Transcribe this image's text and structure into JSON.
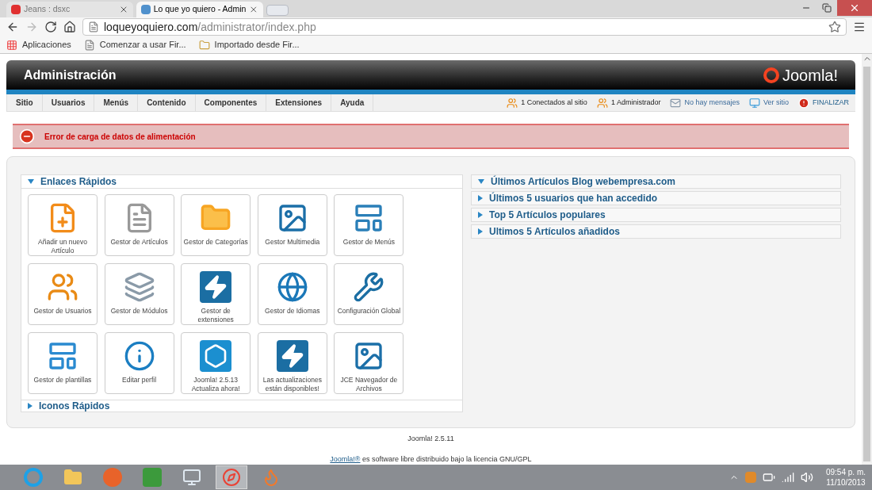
{
  "browser": {
    "tabs": [
      {
        "title": "Jeans : dsxc",
        "selected": false
      },
      {
        "title": "Lo que yo quiero - Admin",
        "selected": true
      }
    ],
    "url": {
      "host": "loqueyoquiero.com",
      "path": "/administrator/index.php"
    },
    "bookmarks": [
      {
        "label": "Aplicaciones",
        "kind": "apps"
      },
      {
        "label": "Comenzar a usar Fir...",
        "kind": "page"
      },
      {
        "label": "Importado desde Fir...",
        "kind": "folder"
      }
    ]
  },
  "header": {
    "title": "Administración",
    "logo": "Joomla!"
  },
  "menu": [
    "Sitio",
    "Usuarios",
    "Menús",
    "Contenido",
    "Componentes",
    "Extensiones",
    "Ayuda"
  ],
  "status": [
    {
      "label": "1 Conectados al sitio",
      "kind": "users"
    },
    {
      "label": "1 Administrador",
      "kind": "users"
    },
    {
      "label": "No hay mensajes",
      "kind": "mail"
    },
    {
      "label": "Ver sitio",
      "kind": "screen"
    },
    {
      "label": "FINALIZAR",
      "kind": "logout"
    }
  ],
  "alert": "Error de carga de datos de alimentación",
  "quick_links": {
    "title": "Enlaces Rápidos",
    "expanded": true,
    "tiles": [
      {
        "label": "Añadir un nuevo Artículo",
        "kind": "add"
      },
      {
        "label": "Gestor de Artículos",
        "kind": "article"
      },
      {
        "label": "Gestor de Categorías",
        "kind": "folder"
      },
      {
        "label": "Gestor Multimedia",
        "kind": "media"
      },
      {
        "label": "Gestor de Menús",
        "kind": "menu"
      },
      {
        "label": "Gestor de Usuarios",
        "kind": "users"
      },
      {
        "label": "Gestor de Módulos",
        "kind": "modules"
      },
      {
        "label": "Gestor de extensiones",
        "kind": "extensions"
      },
      {
        "label": "Gestor de Idiomas",
        "kind": "globe"
      },
      {
        "label": "Configuración Global",
        "kind": "tools"
      },
      {
        "label": "Gestor de plantillas",
        "kind": "template"
      },
      {
        "label": "Editar perfil",
        "kind": "info"
      },
      {
        "label": "Joomla! 2.5.13 Actualiza ahora!",
        "kind": "joomla"
      },
      {
        "label": "Las actualizaciones están disponibles!",
        "kind": "updates"
      },
      {
        "label": "JCE Navegador de Archivos",
        "kind": "media"
      }
    ]
  },
  "quick_icons": {
    "title": "Iconos Rápidos",
    "expanded": false
  },
  "side_panels": [
    {
      "title": "Últimos Artículos Blog webempresa.com",
      "expanded": true
    },
    {
      "title": "Últimos 5 usuarios que han accedido",
      "expanded": false
    },
    {
      "title": "Top 5 Artículos populares",
      "expanded": false
    },
    {
      "title": "Ultimos 5 Artículos añadidos",
      "expanded": false
    }
  ],
  "footer": {
    "version": "Joomla! 2.5.11",
    "license_link": "Joomla!®",
    "license_text": "es software libre distribuido bajo la licencia GNU/GPL"
  },
  "taskbar": {
    "apps": [
      {
        "kind": "ie",
        "selected": false
      },
      {
        "kind": "explorer",
        "selected": false
      },
      {
        "kind": "app",
        "selected": false
      },
      {
        "kind": "w",
        "selected": false
      },
      {
        "kind": "computer",
        "selected": false
      },
      {
        "kind": "chrome",
        "selected": true
      },
      {
        "kind": "firefox",
        "selected": false
      }
    ],
    "time": "09:54 p. m.",
    "date": "11/10/2013"
  }
}
